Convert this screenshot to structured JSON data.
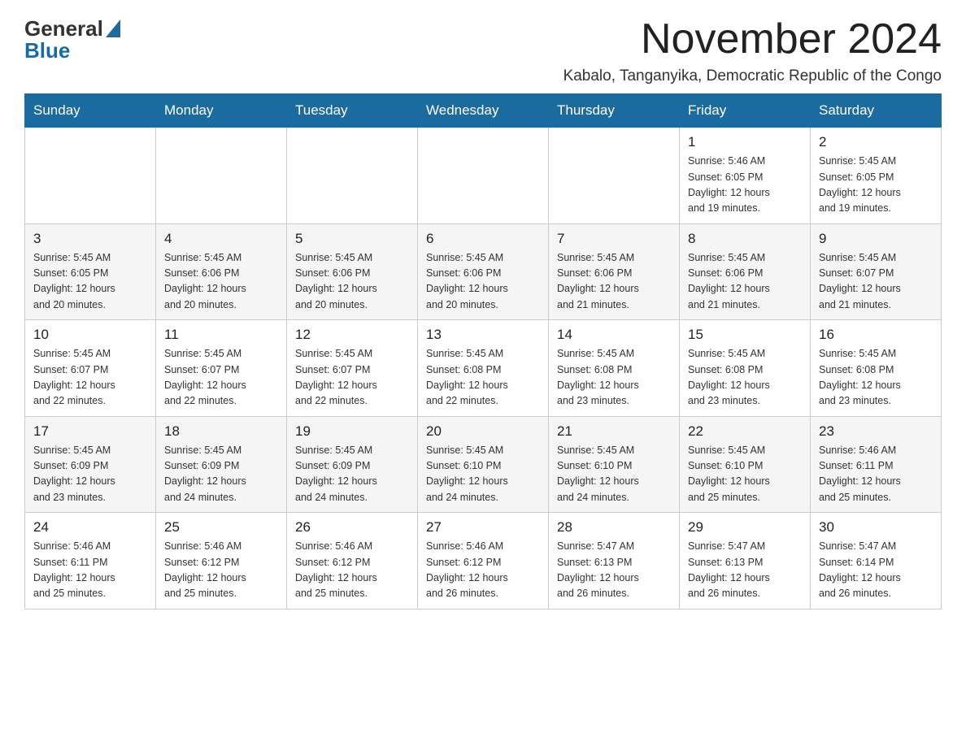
{
  "header": {
    "logo_general": "General",
    "logo_blue": "Blue",
    "month_year": "November 2024",
    "location": "Kabalo, Tanganyika, Democratic Republic of the Congo"
  },
  "weekdays": [
    "Sunday",
    "Monday",
    "Tuesday",
    "Wednesday",
    "Thursday",
    "Friday",
    "Saturday"
  ],
  "weeks": [
    {
      "row_class": "row-white",
      "days": [
        {
          "number": "",
          "info": ""
        },
        {
          "number": "",
          "info": ""
        },
        {
          "number": "",
          "info": ""
        },
        {
          "number": "",
          "info": ""
        },
        {
          "number": "",
          "info": ""
        },
        {
          "number": "1",
          "info": "Sunrise: 5:46 AM\nSunset: 6:05 PM\nDaylight: 12 hours\nand 19 minutes."
        },
        {
          "number": "2",
          "info": "Sunrise: 5:45 AM\nSunset: 6:05 PM\nDaylight: 12 hours\nand 19 minutes."
        }
      ]
    },
    {
      "row_class": "row-gray",
      "days": [
        {
          "number": "3",
          "info": "Sunrise: 5:45 AM\nSunset: 6:05 PM\nDaylight: 12 hours\nand 20 minutes."
        },
        {
          "number": "4",
          "info": "Sunrise: 5:45 AM\nSunset: 6:06 PM\nDaylight: 12 hours\nand 20 minutes."
        },
        {
          "number": "5",
          "info": "Sunrise: 5:45 AM\nSunset: 6:06 PM\nDaylight: 12 hours\nand 20 minutes."
        },
        {
          "number": "6",
          "info": "Sunrise: 5:45 AM\nSunset: 6:06 PM\nDaylight: 12 hours\nand 20 minutes."
        },
        {
          "number": "7",
          "info": "Sunrise: 5:45 AM\nSunset: 6:06 PM\nDaylight: 12 hours\nand 21 minutes."
        },
        {
          "number": "8",
          "info": "Sunrise: 5:45 AM\nSunset: 6:06 PM\nDaylight: 12 hours\nand 21 minutes."
        },
        {
          "number": "9",
          "info": "Sunrise: 5:45 AM\nSunset: 6:07 PM\nDaylight: 12 hours\nand 21 minutes."
        }
      ]
    },
    {
      "row_class": "row-white",
      "days": [
        {
          "number": "10",
          "info": "Sunrise: 5:45 AM\nSunset: 6:07 PM\nDaylight: 12 hours\nand 22 minutes."
        },
        {
          "number": "11",
          "info": "Sunrise: 5:45 AM\nSunset: 6:07 PM\nDaylight: 12 hours\nand 22 minutes."
        },
        {
          "number": "12",
          "info": "Sunrise: 5:45 AM\nSunset: 6:07 PM\nDaylight: 12 hours\nand 22 minutes."
        },
        {
          "number": "13",
          "info": "Sunrise: 5:45 AM\nSunset: 6:08 PM\nDaylight: 12 hours\nand 22 minutes."
        },
        {
          "number": "14",
          "info": "Sunrise: 5:45 AM\nSunset: 6:08 PM\nDaylight: 12 hours\nand 23 minutes."
        },
        {
          "number": "15",
          "info": "Sunrise: 5:45 AM\nSunset: 6:08 PM\nDaylight: 12 hours\nand 23 minutes."
        },
        {
          "number": "16",
          "info": "Sunrise: 5:45 AM\nSunset: 6:08 PM\nDaylight: 12 hours\nand 23 minutes."
        }
      ]
    },
    {
      "row_class": "row-gray",
      "days": [
        {
          "number": "17",
          "info": "Sunrise: 5:45 AM\nSunset: 6:09 PM\nDaylight: 12 hours\nand 23 minutes."
        },
        {
          "number": "18",
          "info": "Sunrise: 5:45 AM\nSunset: 6:09 PM\nDaylight: 12 hours\nand 24 minutes."
        },
        {
          "number": "19",
          "info": "Sunrise: 5:45 AM\nSunset: 6:09 PM\nDaylight: 12 hours\nand 24 minutes."
        },
        {
          "number": "20",
          "info": "Sunrise: 5:45 AM\nSunset: 6:10 PM\nDaylight: 12 hours\nand 24 minutes."
        },
        {
          "number": "21",
          "info": "Sunrise: 5:45 AM\nSunset: 6:10 PM\nDaylight: 12 hours\nand 24 minutes."
        },
        {
          "number": "22",
          "info": "Sunrise: 5:45 AM\nSunset: 6:10 PM\nDaylight: 12 hours\nand 25 minutes."
        },
        {
          "number": "23",
          "info": "Sunrise: 5:46 AM\nSunset: 6:11 PM\nDaylight: 12 hours\nand 25 minutes."
        }
      ]
    },
    {
      "row_class": "row-white",
      "days": [
        {
          "number": "24",
          "info": "Sunrise: 5:46 AM\nSunset: 6:11 PM\nDaylight: 12 hours\nand 25 minutes."
        },
        {
          "number": "25",
          "info": "Sunrise: 5:46 AM\nSunset: 6:12 PM\nDaylight: 12 hours\nand 25 minutes."
        },
        {
          "number": "26",
          "info": "Sunrise: 5:46 AM\nSunset: 6:12 PM\nDaylight: 12 hours\nand 25 minutes."
        },
        {
          "number": "27",
          "info": "Sunrise: 5:46 AM\nSunset: 6:12 PM\nDaylight: 12 hours\nand 26 minutes."
        },
        {
          "number": "28",
          "info": "Sunrise: 5:47 AM\nSunset: 6:13 PM\nDaylight: 12 hours\nand 26 minutes."
        },
        {
          "number": "29",
          "info": "Sunrise: 5:47 AM\nSunset: 6:13 PM\nDaylight: 12 hours\nand 26 minutes."
        },
        {
          "number": "30",
          "info": "Sunrise: 5:47 AM\nSunset: 6:14 PM\nDaylight: 12 hours\nand 26 minutes."
        }
      ]
    }
  ]
}
